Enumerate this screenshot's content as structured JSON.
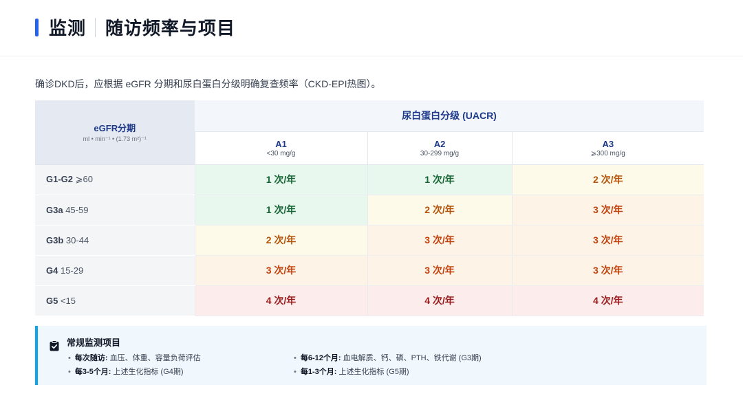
{
  "header": {
    "title": "监测",
    "subtitle": "随访频率与项目"
  },
  "intro": "确诊DKD后，应根据 eGFR 分期和尿白蛋白分级明确复查频率（CKD-EPI热图）。",
  "table": {
    "corner_title": "eGFR分期",
    "corner_unit": "ml • min⁻¹ • (1.73 m²)⁻¹",
    "group_header": "尿白蛋白分级 (UACR)",
    "columns": [
      {
        "name": "A1",
        "range": "<30 mg/g"
      },
      {
        "name": "A2",
        "range": "30-299 mg/g"
      },
      {
        "name": "A3",
        "range": "⩾300 mg/g"
      }
    ],
    "rows": [
      {
        "stage": "G1-G2",
        "range": "⩾60",
        "cells": [
          {
            "text": "1 次/年",
            "level": "green"
          },
          {
            "text": "1 次/年",
            "level": "green"
          },
          {
            "text": "2 次/年",
            "level": "yellow"
          }
        ]
      },
      {
        "stage": "G3a",
        "range": "45-59",
        "cells": [
          {
            "text": "1 次/年",
            "level": "green"
          },
          {
            "text": "2 次/年",
            "level": "yellow"
          },
          {
            "text": "3 次/年",
            "level": "orange"
          }
        ]
      },
      {
        "stage": "G3b",
        "range": "30-44",
        "cells": [
          {
            "text": "2 次/年",
            "level": "yellow"
          },
          {
            "text": "3 次/年",
            "level": "orange"
          },
          {
            "text": "3 次/年",
            "level": "orange"
          }
        ]
      },
      {
        "stage": "G4",
        "range": "15-29",
        "cells": [
          {
            "text": "3 次/年",
            "level": "orange"
          },
          {
            "text": "3 次/年",
            "level": "orange"
          },
          {
            "text": "3 次/年",
            "level": "orange"
          }
        ]
      },
      {
        "stage": "G5",
        "range": "<15",
        "cells": [
          {
            "text": "4 次/年",
            "level": "red"
          },
          {
            "text": "4 次/年",
            "level": "red"
          },
          {
            "text": "4 次/年",
            "level": "red"
          }
        ]
      }
    ]
  },
  "monitoring": {
    "title": "常规监测项目",
    "items": [
      {
        "key": "每次随访:",
        "value": "血压、体重、容量负荷评估"
      },
      {
        "key": "每6-12个月:",
        "value": "血电解质、钙、磷、PTH、铁代谢 (G3期)"
      },
      {
        "key": "每3-5个月:",
        "value": "上述生化指标 (G4期)"
      },
      {
        "key": "每1-3个月:",
        "value": "上述生化指标 (G5期)"
      }
    ],
    "icon": "clipboard-check-icon"
  },
  "colors": {
    "accent": "#2563eb",
    "monitor_border": "#0ea5e9",
    "green": "#166534",
    "yellow": "#b45309",
    "orange": "#c2410c",
    "red": "#991b1b"
  }
}
